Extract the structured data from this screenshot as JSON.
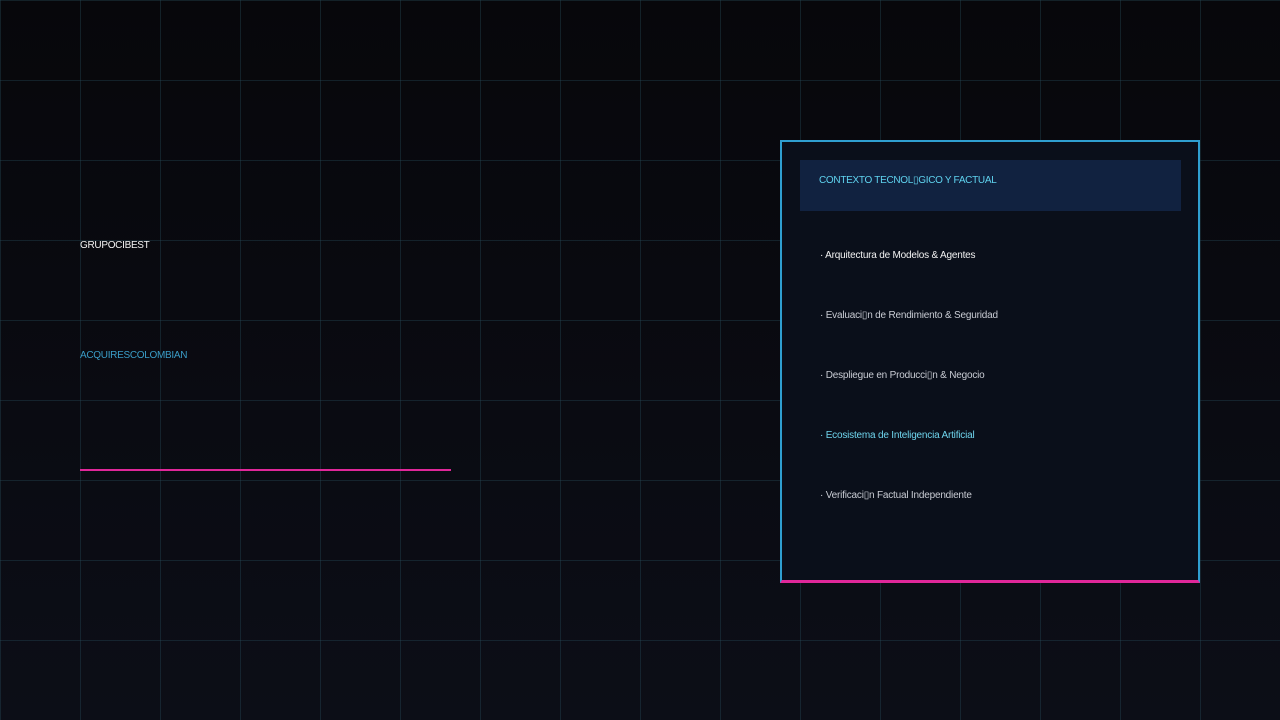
{
  "brand": "GRUPOCIBEST",
  "subtitle": "ACQUIRESCOLOMBIAN",
  "panel": {
    "title": "CONTEXTO TECNOL▯GICO Y FACTUAL",
    "items": [
      {
        "text": "· Arquitectura de Modelos & Agentes",
        "color": "#f2f2f2"
      },
      {
        "text": "· Evaluaci▯n de Rendimiento & Seguridad",
        "color": "#c9ccd4"
      },
      {
        "text": "· Despliegue en Producci▯n & Negocio",
        "color": "#c9ccd4"
      },
      {
        "text": "· Ecosistema de Inteligencia Artificial",
        "color": "#6fd5ee"
      },
      {
        "text": "· Verificaci▯n Factual Independiente",
        "color": "#c9ccd4"
      }
    ]
  },
  "colors": {
    "accent_pink": "#e0279a",
    "accent_blue": "#2f9fd0",
    "subtitle_blue": "#3a9cc7",
    "header_bg": "#112240",
    "background": "#07070b"
  }
}
